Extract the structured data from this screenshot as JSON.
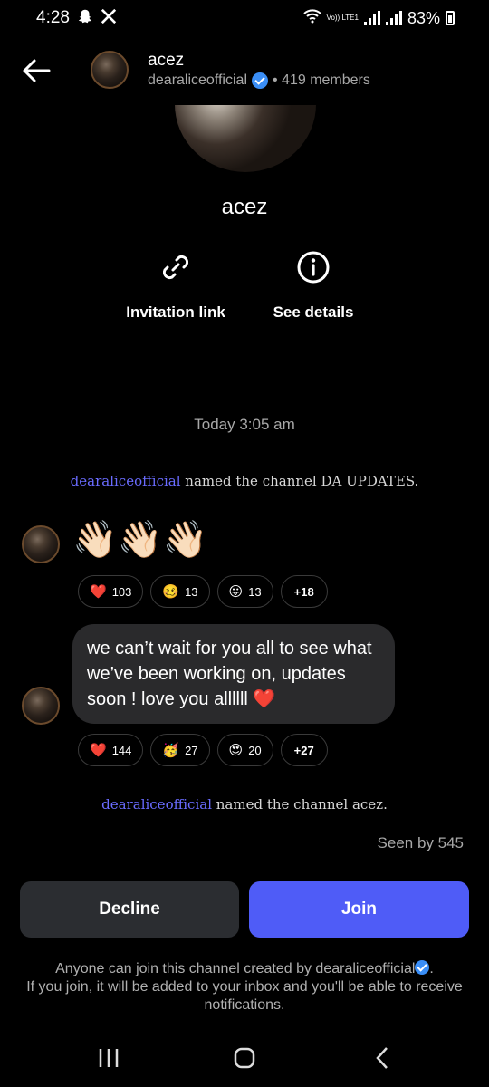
{
  "status_bar": {
    "time": "4:28",
    "icons": [
      "snapchat-icon",
      "x-icon"
    ],
    "network": "Vo)) LTE1",
    "battery": "83%"
  },
  "header": {
    "title": "acez",
    "owner": "dearaliceofficial",
    "members": "• 419 members"
  },
  "channel": {
    "name": "acez",
    "actions": [
      {
        "label": "Invitation link",
        "icon": "link-icon"
      },
      {
        "label": "See details",
        "icon": "info-icon"
      }
    ]
  },
  "chat": {
    "timestamp": "Today 3:05 am",
    "system_messages": [
      {
        "user": "dearaliceofficial",
        "text": " named the channel DA UPDATES."
      },
      {
        "user": "dearaliceofficial",
        "text": " named the channel acez."
      }
    ],
    "messages": [
      {
        "content": "👋🏻👋🏻👋🏻",
        "reactions": [
          {
            "emoji": "❤️",
            "count": "103"
          },
          {
            "emoji": "🥴",
            "count": "13"
          },
          {
            "emoji": "😛",
            "count": "13"
          },
          {
            "emoji": "",
            "count": "+18"
          }
        ]
      },
      {
        "content": "we can’t wait for you all to see what we’ve been working on, updates soon ! love you allllll ❤️",
        "reactions": [
          {
            "emoji": "❤️",
            "count": "144"
          },
          {
            "emoji": "🥳",
            "count": "27"
          },
          {
            "emoji": "😍",
            "count": "20"
          },
          {
            "emoji": "",
            "count": "+27"
          }
        ]
      }
    ],
    "seen": "Seen by 545"
  },
  "actions": {
    "decline": "Decline",
    "join": "Join"
  },
  "footer": {
    "line1_prefix": "Anyone can join this channel created by dearaliceofficial",
    "line1_suffix": ".",
    "line2": "If you join, it will be added to your inbox and you'll be able to receive notifications."
  },
  "colors": {
    "accent": "#4f5cf7",
    "username_link": "#6a6cff",
    "verified": "#3a8ef6",
    "bubble": "#2a2a2c",
    "decline_bg": "#2b2d31"
  }
}
